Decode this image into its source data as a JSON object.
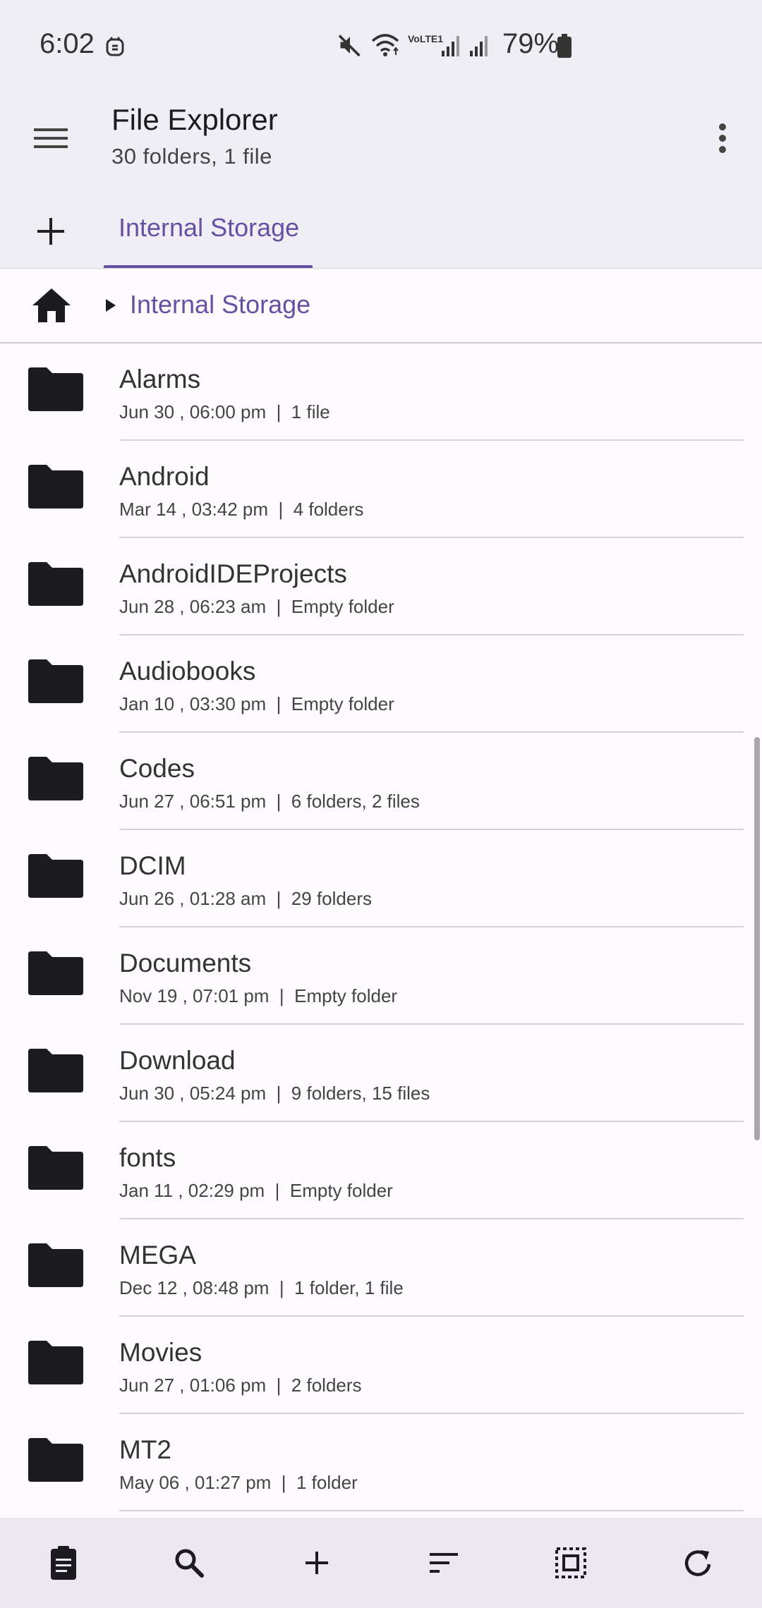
{
  "status_bar": {
    "time": "6:02",
    "battery_percent": "79%",
    "network_label": "VoLTE1",
    "icons": [
      "debug-badge-icon",
      "mute-icon",
      "wifi-icon",
      "volte-icon",
      "signal-icon",
      "signal-icon",
      "battery-icon"
    ]
  },
  "app_bar": {
    "title": "File Explorer",
    "subtitle": "30 folders, 1 file",
    "icons": [
      "menu-icon",
      "more-vert-icon"
    ]
  },
  "tabs": {
    "add_icon": "plus-icon",
    "items": [
      {
        "label": "Internal Storage",
        "selected": true
      }
    ]
  },
  "path_bar": {
    "home_icon": "home-icon",
    "crumbs": [
      {
        "label": "Internal Storage"
      }
    ]
  },
  "files": [
    {
      "name": "Alarms",
      "date": "Jun 30 , 06:00 pm",
      "info": "1 file"
    },
    {
      "name": "Android",
      "date": "Mar 14 , 03:42 pm",
      "info": "4 folders"
    },
    {
      "name": "AndroidIDEProjects",
      "date": "Jun 28 , 06:23 am",
      "info": "Empty folder"
    },
    {
      "name": "Audiobooks",
      "date": "Jan 10 , 03:30 pm",
      "info": "Empty folder"
    },
    {
      "name": "Codes",
      "date": "Jun 27 , 06:51 pm",
      "info": "6 folders, 2 files"
    },
    {
      "name": "DCIM",
      "date": "Jun 26 , 01:28 am",
      "info": "29 folders"
    },
    {
      "name": "Documents",
      "date": "Nov 19 , 07:01 pm",
      "info": "Empty folder"
    },
    {
      "name": "Download",
      "date": "Jun 30 , 05:24 pm",
      "info": "9 folders, 15 files"
    },
    {
      "name": "fonts",
      "date": "Jan 11 , 02:29 pm",
      "info": "Empty folder"
    },
    {
      "name": "MEGA",
      "date": "Dec 12 , 08:48 pm",
      "info": "1 folder, 1 file"
    },
    {
      "name": "Movies",
      "date": "Jun 27 , 01:06 pm",
      "info": "2 folders"
    },
    {
      "name": "MT2",
      "date": "May 06 , 01:27 pm",
      "info": "1 folder"
    }
  ],
  "bottom_bar": {
    "buttons": [
      "clipboard-icon",
      "search-icon",
      "add-icon",
      "sort-icon",
      "select-all-icon",
      "refresh-icon"
    ]
  },
  "colors": {
    "accent": "#6750A4",
    "background": "#FEFBFF",
    "surface": "#F0EEF5",
    "bottom_bar": "#ECE7F0"
  }
}
